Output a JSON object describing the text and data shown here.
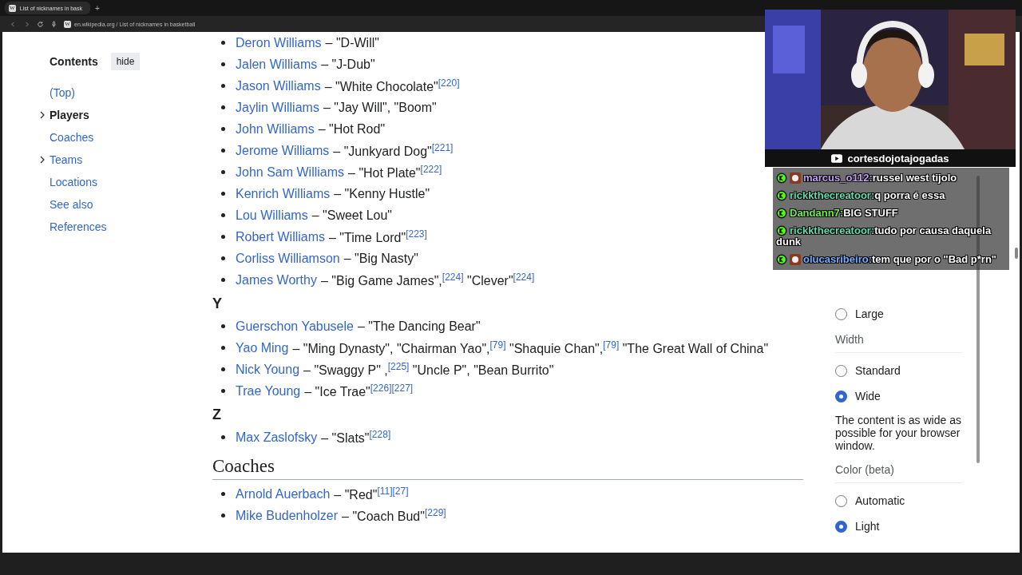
{
  "browser": {
    "tab": {
      "favicon": "W",
      "title": "List of nicknames in bask",
      "new_tab": "+"
    },
    "address_favicon": "W",
    "address": "en.wikipedia.org / List of nicknames in basketball"
  },
  "toc": {
    "title": "Contents",
    "hide": "hide",
    "items": [
      {
        "label": "(Top)",
        "expandable": false,
        "selected": false
      },
      {
        "label": "Players",
        "expandable": true,
        "selected": true
      },
      {
        "label": "Coaches",
        "expandable": false,
        "selected": false
      },
      {
        "label": "Teams",
        "expandable": true,
        "selected": false
      },
      {
        "label": "Locations",
        "expandable": false,
        "selected": false
      },
      {
        "label": "See also",
        "expandable": false,
        "selected": false
      },
      {
        "label": "References",
        "expandable": false,
        "selected": false
      }
    ]
  },
  "sections": [
    {
      "kind": "list",
      "rows": [
        {
          "name": "Deron Williams",
          "text": "– \"D-Will\""
        },
        {
          "name": "Jalen Williams",
          "text": "– \"J-Dub\""
        },
        {
          "name": "Jason Williams",
          "text": "– \"White Chocolate\"$^{[220]}$"
        },
        {
          "name": "Jaylin Williams",
          "text": "– \"Jay Will\", \"Boom\""
        },
        {
          "name": "John Williams",
          "text": "– \"Hot Rod\""
        },
        {
          "name": "Jerome Williams",
          "text": "– \"Junkyard Dog\"$^{[221]}$"
        },
        {
          "name": "John Sam Williams",
          "text": "– \"Hot Plate\"$^{[222]}$"
        },
        {
          "name": "Kenrich Williams",
          "text": "– \"Kenny Hustle\""
        },
        {
          "name": "Lou Williams",
          "text": "– \"Sweet Lou\""
        },
        {
          "name": "Robert Williams",
          "text": "– \"Time Lord\"$^{[223]}$"
        },
        {
          "name": "Corliss Williamson",
          "text": "– \"Big Nasty\""
        },
        {
          "name": "James Worthy",
          "text": "– \"Big Game James\",$^{[224]}$ \"Clever\"$^{[224]}$"
        }
      ]
    },
    {
      "kind": "letter",
      "title": "Y"
    },
    {
      "kind": "list",
      "rows": [
        {
          "name": "Guerschon Yabusele",
          "text": "– \"The Dancing Bear\""
        },
        {
          "name": "Yao Ming",
          "text": "– \"Ming Dynasty\", \"Chairman Yao\",$^{[79]}$ \"Shaquie Chan\",$^{[79]}$ \"The Great Wall of China\""
        },
        {
          "name": "Nick Young",
          "text": "– \"Swaggy P\" ,$^{[225]}$ \"Uncle P\", \"Bean Burrito\""
        },
        {
          "name": "Trae Young",
          "text": "– \"Ice Trae\"$^{[226][227]}$"
        }
      ]
    },
    {
      "kind": "letter",
      "title": "Z"
    },
    {
      "kind": "list",
      "rows": [
        {
          "name": "Max Zaslofsky",
          "text": "– \"Slats\"$^{[228]}$"
        }
      ]
    },
    {
      "kind": "heading",
      "title": "Coaches"
    },
    {
      "kind": "list",
      "rows": [
        {
          "name": "Arnold Auerbach",
          "text": "– \"Red\"$^{[11][27]}$"
        },
        {
          "name": "Mike Budenholzer",
          "text": "– \"Coach Bud\"$^{[229]}$"
        }
      ]
    }
  ],
  "appearance": [
    {
      "kind": "radio",
      "label": "Large",
      "selected": false
    },
    {
      "kind": "heading",
      "label": "Width"
    },
    {
      "kind": "radio",
      "label": "Standard",
      "selected": false
    },
    {
      "kind": "radio",
      "label": "Wide",
      "selected": true
    },
    {
      "kind": "note",
      "label": "The content is as wide as possible for your browser window."
    },
    {
      "kind": "heading",
      "label": "Color (beta)"
    },
    {
      "kind": "radio",
      "label": "Automatic",
      "selected": false
    },
    {
      "kind": "radio",
      "label": "Light",
      "selected": true
    }
  ],
  "stream": {
    "channel": "cortesdojotajogadas",
    "chat": [
      {
        "user": "marcus_o112:",
        "text": "russel west tijolo",
        "color": "#c49cf5",
        "avatar": true
      },
      {
        "user": "rickkthecreatoor:",
        "text": "q porra é essa",
        "color": "#5fe0b0",
        "avatar": false
      },
      {
        "user": "Dandann7:",
        "text": "BIG STUFF",
        "color": "#6cf04a",
        "avatar": false
      },
      {
        "user": "rickkthecreatoor:",
        "text": "tudo por causa daquela dunk",
        "color": "#5fe0b0",
        "avatar": false
      },
      {
        "user": "olucasribeiro:",
        "text": "tem que por o \"Bad p*rn\"",
        "color": "#6fb0ff",
        "avatar": true
      }
    ]
  }
}
